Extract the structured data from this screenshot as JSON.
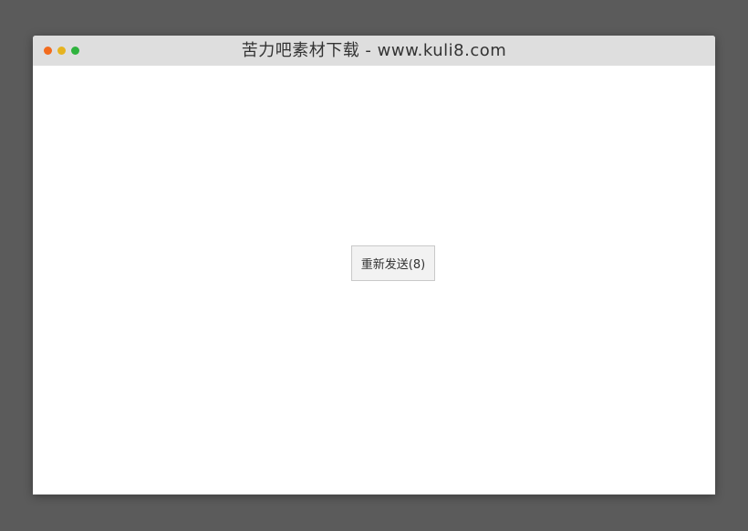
{
  "window": {
    "title": "苦力吧素材下载 - www.kuli8.com",
    "traffic_lights": {
      "close": "#f26b1d",
      "minimize": "#e6b320",
      "maximize": "#2fb33e"
    }
  },
  "main": {
    "resend_button_label": "重新发送(8)"
  }
}
